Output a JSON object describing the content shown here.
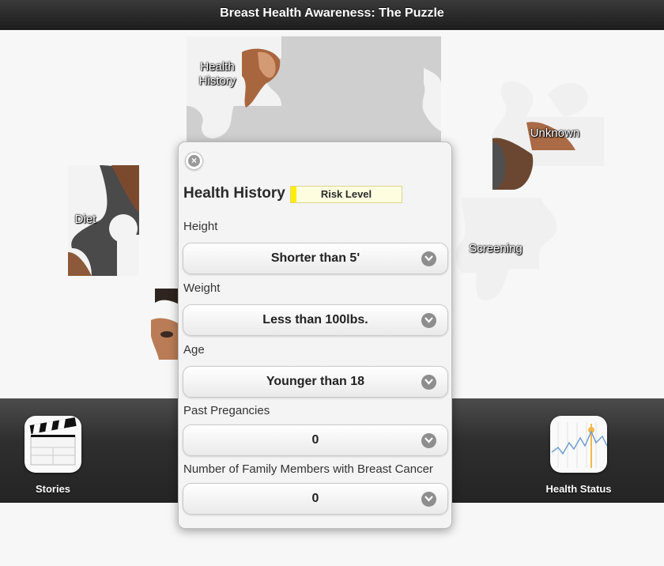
{
  "title": "Breast Health Awareness: The Puzzle",
  "pieces": {
    "health_history": "Health History",
    "diet": "Diet",
    "unknown": "Unknown",
    "screening": "Screening"
  },
  "dock": {
    "stories": "Stories",
    "health_status": "Health Status"
  },
  "modal": {
    "title": "Health History",
    "risk_label": "Risk Level",
    "risk_level_fraction": 0.05,
    "fields": [
      {
        "label": "Height",
        "value": "Shorter than 5'"
      },
      {
        "label": "Weight",
        "value": "Less than 100lbs."
      },
      {
        "label": "Age",
        "value": "Younger than 18"
      },
      {
        "label": "Past Pregancies",
        "value": "0"
      },
      {
        "label": "Number of Family Members with Breast Cancer",
        "value": "0"
      }
    ]
  },
  "colors": {
    "risk_bar": "#ffee00",
    "risk_bg": "#fffde0"
  }
}
